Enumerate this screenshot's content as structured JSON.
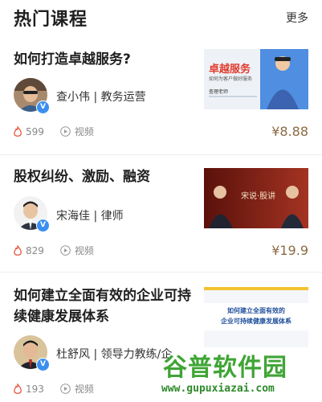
{
  "header": {
    "title": "热门课程",
    "more_label": "更多"
  },
  "courses": [
    {
      "title": "如何打造卓越服务?",
      "teacher": "查小伟 | 教务运营",
      "likes": "599",
      "video_label": "视频",
      "price": "¥8.88",
      "thumb_title": "卓越服务",
      "thumb_sub": "如何为客户做好服务",
      "thumb_name": "查理老师"
    },
    {
      "title": "股权纠纷、激励、融资",
      "teacher": "宋海佳 | 律师",
      "likes": "829",
      "video_label": "视频",
      "price": "¥19.9",
      "thumb_title": "宋说·股讲"
    },
    {
      "title": "如何建立全面有效的企业可持续健康发展体系",
      "teacher": "杜舒风 | 领导力教练/企",
      "likes": "193",
      "video_label": "视频",
      "price": "",
      "thumb_title_line1": "如何建立全面有效的",
      "thumb_title_line2": "企业可持续健康发展体系"
    }
  ],
  "watermark": {
    "text": "谷普软件园",
    "url": "www.gupuxiazai.com"
  },
  "colors": {
    "price": "#8b6a44",
    "badge": "#3b8ff0",
    "fire": "#e8553f",
    "thumb3_accent": "#1f4f9c"
  }
}
